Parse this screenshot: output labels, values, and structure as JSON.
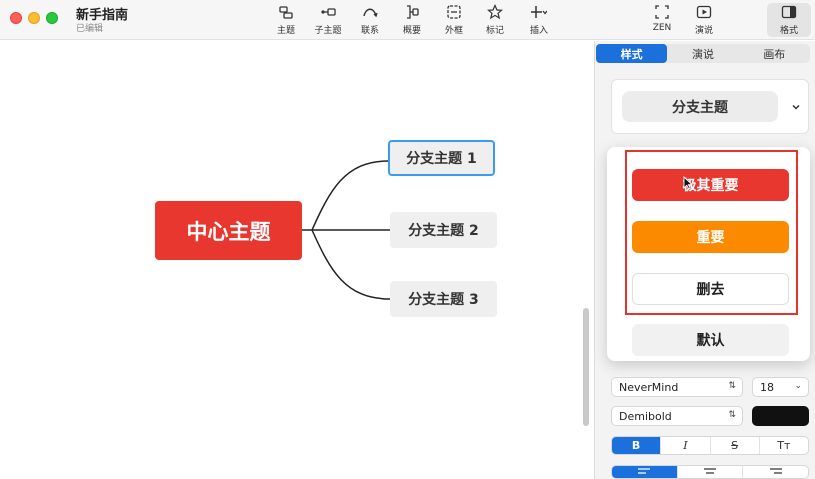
{
  "window": {
    "title": "新手指南",
    "subtitle": "已编辑"
  },
  "toolbar": {
    "items": [
      {
        "label": "主题",
        "icon": "topic-icon"
      },
      {
        "label": "子主题",
        "icon": "subtopic-icon"
      },
      {
        "label": "联系",
        "icon": "relationship-icon"
      },
      {
        "label": "概要",
        "icon": "summary-icon"
      },
      {
        "label": "外框",
        "icon": "boundary-icon"
      },
      {
        "label": "标记",
        "icon": "star-icon"
      },
      {
        "label": "插入",
        "icon": "plus-icon"
      }
    ],
    "right": [
      {
        "label": "ZEN",
        "icon": "zen-icon"
      },
      {
        "label": "演说",
        "icon": "play-icon"
      },
      {
        "label": "格式",
        "icon": "format-panel-icon"
      }
    ]
  },
  "mindmap": {
    "central": "中心主题",
    "branches": [
      "分支主题 1",
      "分支主题 2",
      "分支主题 3"
    ],
    "colors": {
      "central": "#e8372f",
      "branch": "#efefef",
      "selected": "#3a9bf1"
    }
  },
  "panel": {
    "tabs": [
      "样式",
      "演说",
      "画布"
    ],
    "active_tab": "样式",
    "style_value": "分支主题",
    "dropdown": {
      "critical": "极其重要",
      "important": "重要",
      "strike": "删去",
      "default": "默认"
    },
    "font_family": "NeverMind",
    "font_size": "18",
    "font_weight": "Demibold",
    "text_color": "#111111",
    "format_buttons": [
      "B",
      "I",
      "S",
      "Tт"
    ],
    "align_buttons": [
      "left",
      "center",
      "right"
    ]
  }
}
